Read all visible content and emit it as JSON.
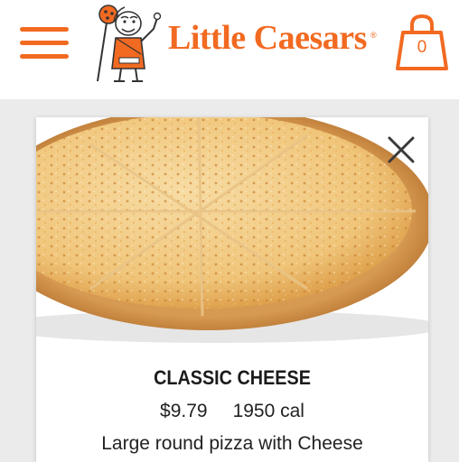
{
  "header": {
    "brand_name": "Little Caesars",
    "registered_mark": "®",
    "cart_count": "0"
  },
  "product": {
    "name": "CLASSIC CHEESE",
    "price": "$9.79",
    "calories": "1950 cal",
    "description": "Large round pizza with Cheese"
  },
  "icons": {
    "menu": "hamburger-menu-icon",
    "cart": "shopping-bag-icon",
    "close": "close-icon"
  },
  "colors": {
    "brand_orange": "#f26a21",
    "page_background": "#ebebeb",
    "card_background": "#ffffff",
    "text": "#222222"
  }
}
